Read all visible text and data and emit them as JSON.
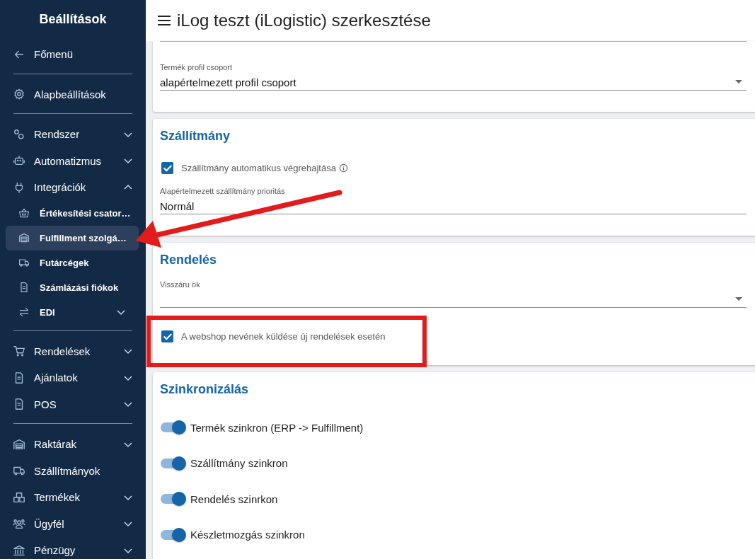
{
  "sidebar": {
    "title": "Beállítások",
    "sections": [
      [
        {
          "label": "Főmenü"
        }
      ],
      [
        {
          "label": "Alapbeállítások"
        }
      ],
      [
        {
          "label": "Rendszer",
          "expanded": false
        },
        {
          "label": "Automatizmus",
          "expanded": false
        },
        {
          "label": "Integrációk",
          "expanded": true,
          "children": [
            {
              "label": "Értékesítési csator…",
              "selected": false
            },
            {
              "label": "Fulfillment szolgá…",
              "selected": true
            },
            {
              "label": "Futárcégek",
              "selected": false
            },
            {
              "label": "Számlázási fiókok",
              "selected": false
            },
            {
              "label": "EDI",
              "selected": false,
              "expanded": false
            }
          ]
        }
      ],
      [
        {
          "label": "Rendelések",
          "expanded": false
        },
        {
          "label": "Ajánlatok",
          "expanded": false
        },
        {
          "label": "POS",
          "expanded": false
        }
      ],
      [
        {
          "label": "Raktárak",
          "expanded": false
        },
        {
          "label": "Szállítmányok"
        },
        {
          "label": "Termékek",
          "expanded": false
        },
        {
          "label": "Ügyfél",
          "expanded": false
        },
        {
          "label": "Pénzügy",
          "expanded": false
        }
      ]
    ]
  },
  "header": {
    "title": "iLog teszt (iLogistic) szerkesztése"
  },
  "cards": [
    {
      "fields": [
        {
          "kind": "select",
          "label": "Termék profil csoport",
          "value": "alapértelmezett profil csoport"
        }
      ]
    },
    {
      "title": "Szállítmány",
      "fields": [
        {
          "kind": "checkbox",
          "label": "Szállítmány automatikus végrehajtása",
          "checked": true,
          "info": true
        },
        {
          "kind": "text",
          "label": "Alapértelmezett szállítmány prioritás",
          "value": "Normál"
        }
      ]
    },
    {
      "title": "Rendelés",
      "fields": [
        {
          "kind": "select",
          "label": "Visszáru ok"
        },
        {
          "kind": "checkbox",
          "label": "A webshop nevének küldése új rendelések esetén",
          "checked": true
        }
      ]
    },
    {
      "title": "Szinkronizálás",
      "fields": [
        {
          "kind": "switch",
          "label": "Termék szinkron (ERP -> Fulfillment)",
          "on": true
        },
        {
          "kind": "switch",
          "label": "Szállítmány szinkron",
          "on": true
        },
        {
          "kind": "switch",
          "label": "Rendelés szinrkon",
          "on": true
        },
        {
          "kind": "switch",
          "label": "Készletmozgás szinkron",
          "on": true
        }
      ]
    }
  ],
  "annotations": {
    "arrow": true,
    "highlight_frame": true
  }
}
